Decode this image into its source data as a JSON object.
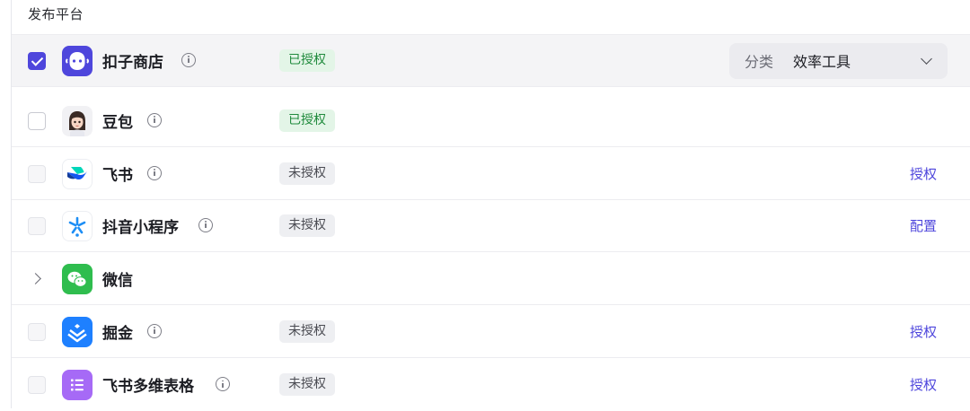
{
  "section_title": "发布平台",
  "colors": {
    "accent": "#4e46dc",
    "authorized_bg": "#e3f5e7",
    "authorized_text": "#1f8a3c",
    "unauthorized_bg": "#eeeff2"
  },
  "platforms": [
    {
      "name": "扣子商店",
      "icon": "coze-store-icon",
      "status": "已授权",
      "checked": true,
      "category_label": "分类",
      "category_value": "效率工具"
    },
    {
      "name": "豆包",
      "icon": "doubao-avatar-icon",
      "status": "已授权",
      "checked": false
    },
    {
      "name": "飞书",
      "icon": "feishu-icon",
      "status": "未授权",
      "checked": false,
      "action": "授权"
    },
    {
      "name": "抖音小程序",
      "icon": "douyin-miniapp-icon",
      "status": "未授权",
      "checked": false,
      "action": "配置"
    },
    {
      "name": "微信",
      "icon": "wechat-icon",
      "expandable": true
    },
    {
      "name": "掘金",
      "icon": "juejin-icon",
      "status": "未授权",
      "checked": false,
      "action": "授权"
    },
    {
      "name": "飞书多维表格",
      "icon": "feishu-bitable-icon",
      "status": "未授权",
      "checked": false,
      "action": "授权"
    }
  ]
}
